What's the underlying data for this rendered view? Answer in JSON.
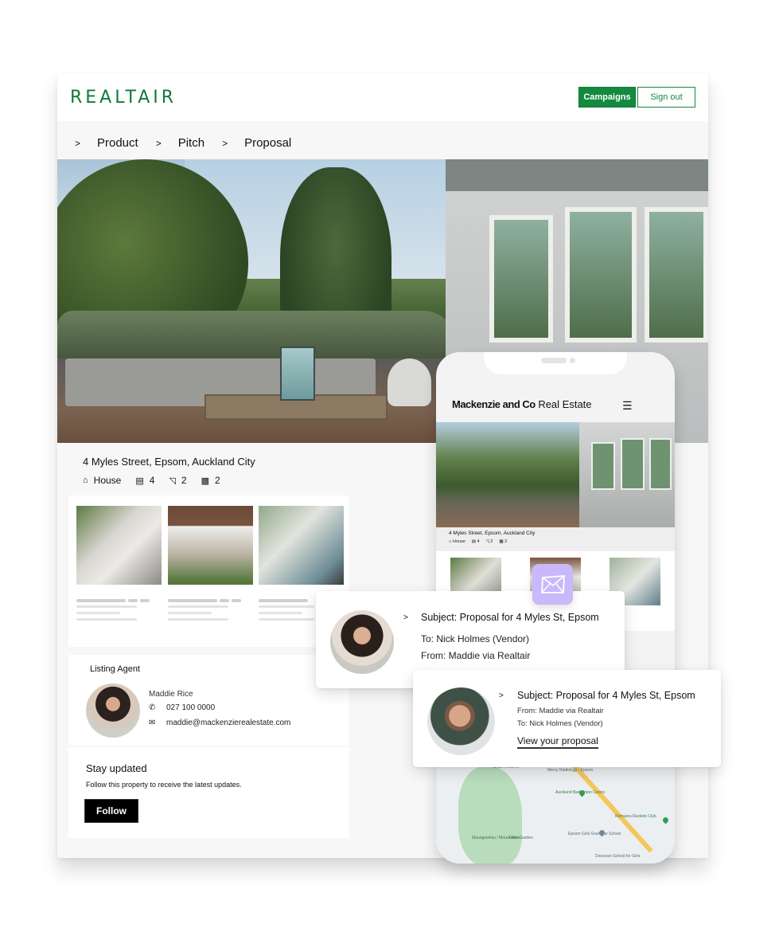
{
  "header": {
    "logo": "REALTAIR",
    "campaigns_label": "Campaigns",
    "signout_label": "Sign out",
    "brand_color": "#138a3e"
  },
  "breadcrumb": {
    "separator": ">",
    "items": [
      "Product",
      "Pitch",
      "Proposal"
    ]
  },
  "property": {
    "address": "4 Myles Street, Epsom, Auckland City",
    "type": "House",
    "bedrooms": "4",
    "bathrooms": "2",
    "parking": "2",
    "icons": {
      "type": "home-icon",
      "bedrooms": "bed-icon",
      "bathrooms": "bath-icon",
      "parking": "car-icon"
    }
  },
  "listing_agent": {
    "title": "Listing Agent",
    "name": "Maddie Rice",
    "phone": "027 100 0000",
    "email": "maddie@mackenzierealestate.com"
  },
  "follow": {
    "title": "Stay updated",
    "description": "Follow this property to receive the latest updates.",
    "button_label": "Follow"
  },
  "phone": {
    "brand_bold": "Mackenzie and Co",
    "brand_regular": " Real Estate",
    "address": "4 Myles Street, Epsom, Auckland City",
    "type": "House",
    "bedrooms": "4",
    "bathrooms": "2",
    "parking": "2",
    "map_labels": {
      "reserve": "Tahaki Reserve",
      "mount": "Maungawhau / Mount Eden",
      "garden": "Eden Garden",
      "radiology": "Mercy Radiology - Epsom",
      "badminton": "Auckland Badminton Centre",
      "school": "Epsom Girls Grammar School",
      "rackets": "Remuera Rackets Club",
      "diocesan": "Diocesan School for Girls"
    }
  },
  "mail_tile": {
    "icon": "envelope-icon",
    "color": "#c9b8fb"
  },
  "notifications": [
    {
      "chevron": ">",
      "subject": "Subject: Proposal for 4 Myles St, Epsom",
      "to": "To: Nick Holmes (Vendor)",
      "from": "From: Maddie via Realtair"
    },
    {
      "chevron": ">",
      "subject": "Subject: Proposal for 4 Myles St, Epsom",
      "from": "From: Maddie via Realtair",
      "to": "To: Nick Holmes (Vendor)",
      "link": "View your proposal"
    }
  ]
}
